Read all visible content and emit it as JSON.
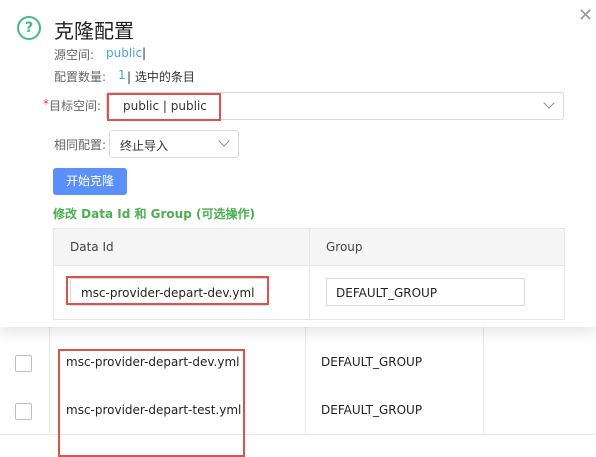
{
  "dialog": {
    "title": "克隆配置",
    "source_ns_label": "源空间:",
    "source_ns_value": "public",
    "source_ns_suffix": "|",
    "count_label": "配置数量:",
    "count_value": "1",
    "count_suffix": "| 选中的条目",
    "target_required_mark": "*",
    "target_label": "目标空间:",
    "target_value": "public | public",
    "same_config_label": "相同配置:",
    "same_config_value": "终止导入",
    "start_button": "开始克隆",
    "modify_hint": "修改 Data Id 和 Group (可选操作)",
    "table": {
      "col_dataid": "Data Id",
      "col_group": "Group",
      "row_dataid": "msc-provider-depart-dev.yml",
      "row_group": "DEFAULT_GROUP"
    }
  },
  "background_table": {
    "rows": [
      {
        "data_id": "msc-provider-depart-dev.yml",
        "group": "DEFAULT_GROUP"
      },
      {
        "data_id": "msc-provider-depart-test.yml",
        "group": "DEFAULT_GROUP"
      }
    ]
  },
  "colors": {
    "accent": "#5b8ff9",
    "link": "#4aa3df",
    "hint": "#4caf50",
    "highlight": "#d9534f"
  }
}
